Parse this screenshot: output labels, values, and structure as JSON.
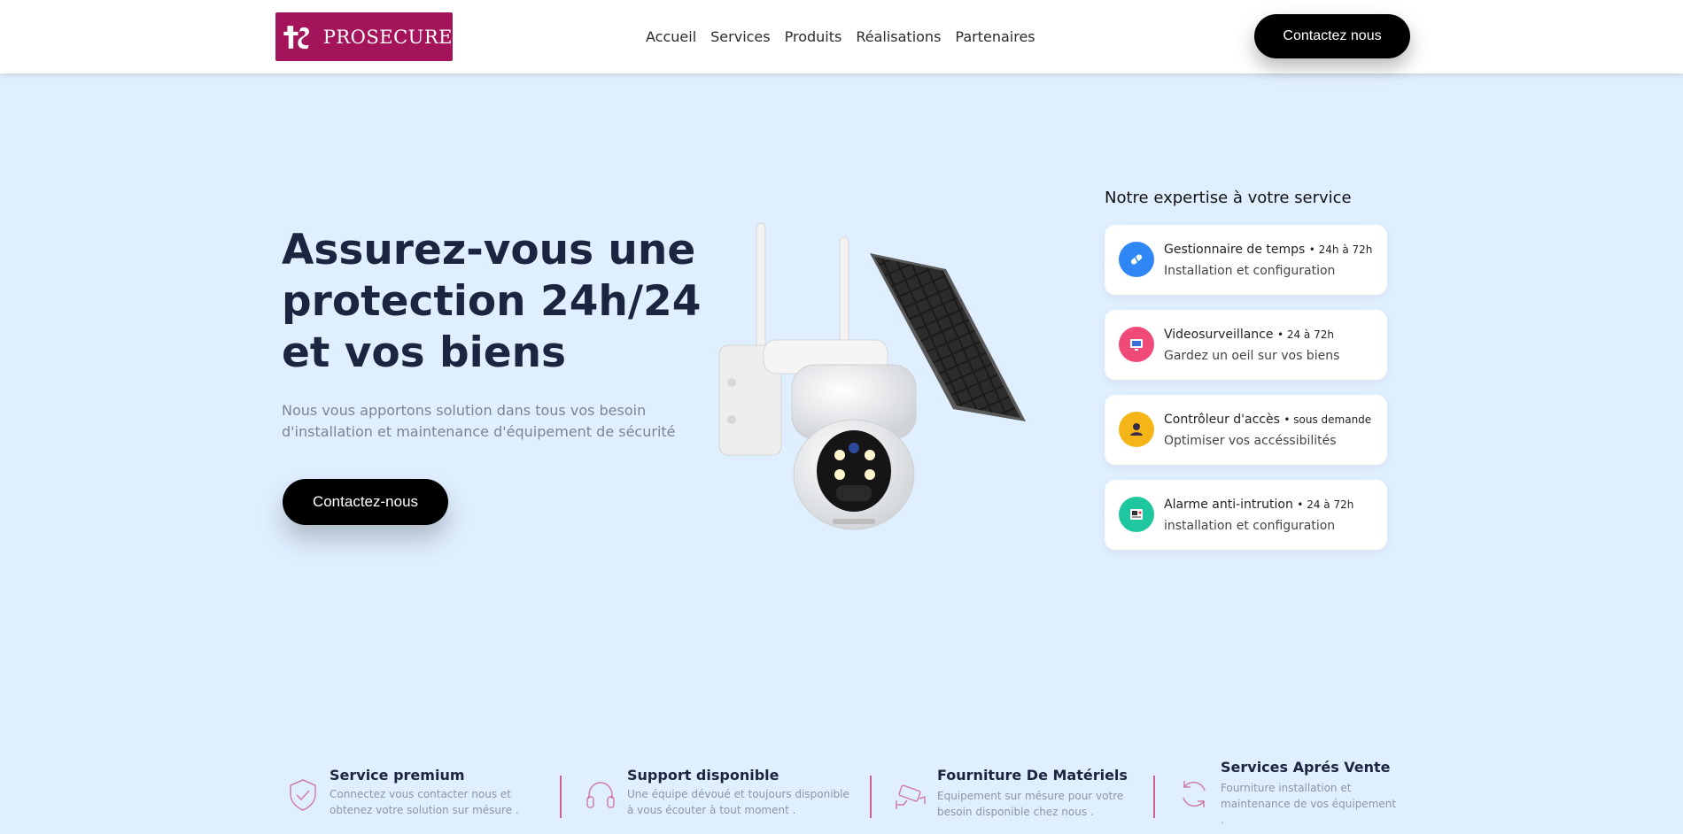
{
  "header": {
    "brand": "PROSECURE",
    "nav": [
      "Accueil",
      "Services",
      "Produits",
      "Réalisations",
      "Partenaires"
    ],
    "cta": "Contactez nous"
  },
  "hero": {
    "title_lines": [
      "Assurez-vous une",
      "protection 24h/24",
      "et vos biens"
    ],
    "subtitle_lines": [
      "Nous vous apportons solution dans tous vos besoin",
      "d'installation et maintenance d'équipement de sécurité"
    ],
    "cta": "Contactez-nous"
  },
  "expertise": {
    "title": "Notre expertise à votre service",
    "items": [
      {
        "name": "Gestionnaire de temps",
        "time": "• 24h à 72h",
        "desc": "Installation et configuration",
        "icon": "pill-icon",
        "color": "#2f86f5"
      },
      {
        "name": "Videosurveillance",
        "time": "• 24 à 72h",
        "desc": "Gardez un oeil sur vos biens",
        "icon": "monitor-icon",
        "color": "#f04a78"
      },
      {
        "name": "Contrôleur d'accès",
        "time": "• sous demande",
        "desc": "Optimiser vos accéssibilités",
        "icon": "user-icon",
        "color": "#f5b517"
      },
      {
        "name": "Alarme anti-intrution",
        "time": "• 24 à 72h",
        "desc": "installation et configuration",
        "icon": "alarm-icon",
        "color": "#1fc7a0"
      }
    ]
  },
  "features": [
    {
      "title": "Service premium",
      "lines": [
        "Connectez vous contacter nous et",
        "obtenez votre solution sur mésure ."
      ],
      "icon": "shield-check-icon"
    },
    {
      "title": "Support disponible",
      "lines": [
        "Une équipe dévoué et toujours disponible",
        "à vous écouter à tout moment ."
      ],
      "icon": "headset-icon"
    },
    {
      "title": "Fourniture De Matériels",
      "lines": [
        "Equipement sur mésure pour votre",
        "besoin disponible chez nous ."
      ],
      "icon": "cctv-icon"
    },
    {
      "title": "Services Aprés Vente",
      "lines": [
        "Fourniture installation et",
        "maintenance de vos équipement",
        "."
      ],
      "icon": "refresh-icon"
    }
  ],
  "colors": {
    "brand": "#a4145a",
    "background": "#e0efff",
    "feature_icon": "#c7336b"
  }
}
